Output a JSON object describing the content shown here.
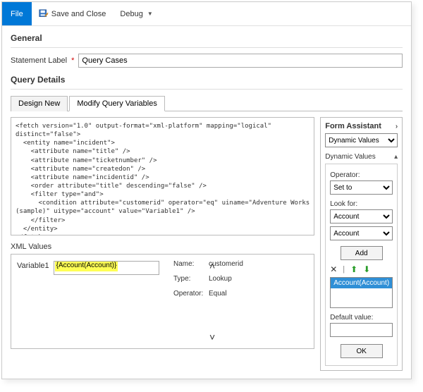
{
  "toolbar": {
    "file": "File",
    "save_close": "Save and Close",
    "debug": "Debug"
  },
  "general": {
    "title": "General",
    "statement_label": "Statement Label",
    "statement_value": "Query Cases"
  },
  "query_details": {
    "title": "Query Details",
    "tabs": {
      "design_new": "Design New",
      "modify_vars": "Modify Query Variables"
    },
    "fetch_xml": "<fetch version=\"1.0\" output-format=\"xml-platform\" mapping=\"logical\"\ndistinct=\"false\">\n  <entity name=\"incident\">\n    <attribute name=\"title\" />\n    <attribute name=\"ticketnumber\" />\n    <attribute name=\"createdon\" />\n    <attribute name=\"incidentid\" />\n    <order attribute=\"title\" descending=\"false\" />\n    <filter type=\"and\">\n      <condition attribute=\"customerid\" operator=\"eq\" uiname=\"Adventure Works\n(sample)\" uitype=\"account\" value=\"Variable1\" />\n    </filter>\n  </entity>\n</fetch>",
    "xml_values_title": "XML Values",
    "variable_label": "Variable1",
    "variable_value": "{Account(Account)}",
    "meta": {
      "name_label": "Name:",
      "name_value": "customerid",
      "type_label": "Type:",
      "type_value": "Lookup",
      "operator_label": "Operator:",
      "operator_value": "Equal"
    }
  },
  "assistant": {
    "title": "Form Assistant",
    "dynamic_values": "Dynamic Values",
    "operator_label": "Operator:",
    "operator_value": "Set to",
    "lookfor_label": "Look for:",
    "lookfor1": "Account",
    "lookfor2": "Account",
    "add": "Add",
    "selected_item": "Account(Account)",
    "default_value_label": "Default value:",
    "default_value": "",
    "ok": "OK"
  }
}
